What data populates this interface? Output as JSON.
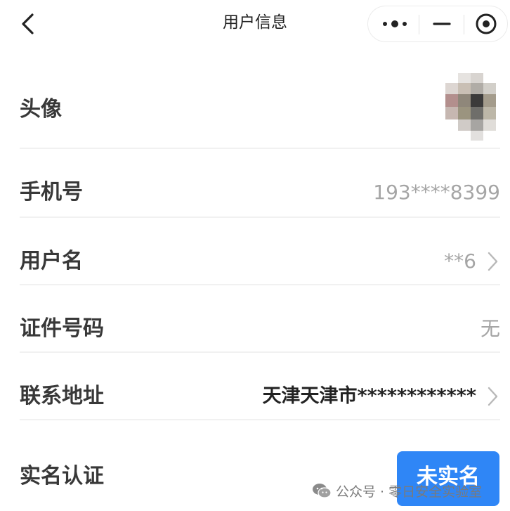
{
  "header": {
    "title": "用户信息",
    "back_icon": "chevron-left-icon",
    "capsule": {
      "more_icon": "more-dots-icon",
      "minimize_icon": "minimize-icon",
      "close_icon": "target-close-icon"
    }
  },
  "rows": {
    "avatar": {
      "label": "头像"
    },
    "phone": {
      "label": "手机号",
      "value": "193****8399"
    },
    "username": {
      "label": "用户名",
      "value": "**6"
    },
    "id_number": {
      "label": "证件号码",
      "value": "无"
    },
    "address": {
      "label": "联系地址",
      "value": "天津天津市************"
    },
    "real_name": {
      "label": "实名认证",
      "button_label": "未实名"
    }
  },
  "watermark": {
    "text": "公众号 · 零日安全实验室",
    "icon": "wechat-icon"
  },
  "colors": {
    "accent": "#2f86f6",
    "value_gray": "#a5a5a5",
    "label": "#383838"
  }
}
